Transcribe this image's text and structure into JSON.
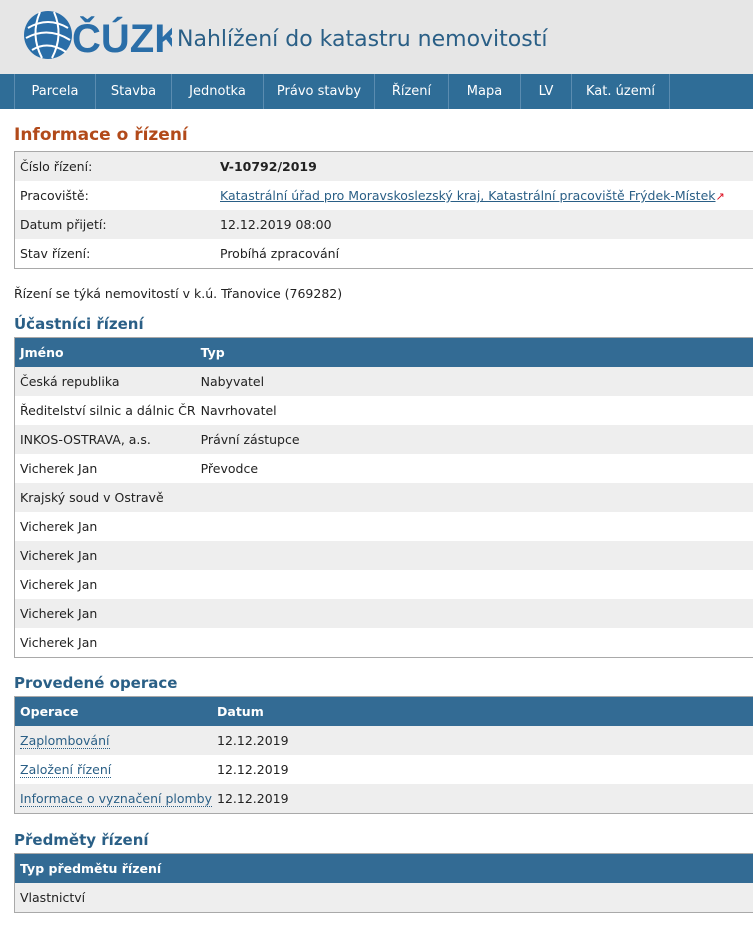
{
  "header": {
    "logo_text": "ČÚZK",
    "title": "Nahlížení do katastru nemovitostí"
  },
  "nav": [
    "Parcela",
    "Stavba",
    "Jednotka",
    "Právo stavby",
    "Řízení",
    "Mapa",
    "LV",
    "Kat. území"
  ],
  "info": {
    "heading": "Informace o řízení",
    "rows": [
      {
        "label": "Číslo řízení:",
        "value": "V-10792/2019"
      },
      {
        "label": "Pracoviště:",
        "value": "Katastrální úřad pro Moravskoslezský kraj, Katastrální pracoviště Frýdek-Místek"
      },
      {
        "label": "Datum přijetí:",
        "value": "12.12.2019 08:00"
      },
      {
        "label": "Stav řízení:",
        "value": "Probíhá zpracování"
      }
    ]
  },
  "note": "Řízení se týká nemovitostí v k.ú. Třanovice (769282)",
  "participants": {
    "heading": "Účastníci řízení",
    "columns": [
      "Jméno",
      "Typ"
    ],
    "rows": [
      [
        "Česká republika",
        "Nabyvatel"
      ],
      [
        "Ředitelství silnic a dálnic ČR",
        "Navrhovatel"
      ],
      [
        "INKOS-OSTRAVA, a.s.",
        "Právní zástupce"
      ],
      [
        "Vicherek Jan",
        "Převodce"
      ],
      [
        "Krajský soud v Ostravě",
        ""
      ],
      [
        "Vicherek Jan",
        ""
      ],
      [
        "Vicherek Jan",
        ""
      ],
      [
        "Vicherek Jan",
        ""
      ],
      [
        "Vicherek Jan",
        ""
      ],
      [
        "Vicherek Jan",
        ""
      ]
    ]
  },
  "operations": {
    "heading": "Provedené operace",
    "columns": [
      "Operace",
      "Datum"
    ],
    "rows": [
      [
        "Zaplombování",
        "12.12.2019"
      ],
      [
        "Založení řízení",
        "12.12.2019"
      ],
      [
        "Informace o vyznačení plomby",
        "12.12.2019"
      ]
    ]
  },
  "subjects": {
    "heading": "Předměty řízení",
    "columns": [
      "Typ předmětu řízení"
    ],
    "rows": [
      [
        "Vlastnictví"
      ]
    ]
  },
  "colors": {
    "nav_bg": "#2f6d97",
    "heading_orange": "#b24a1a",
    "heading_blue": "#2a5f86"
  }
}
